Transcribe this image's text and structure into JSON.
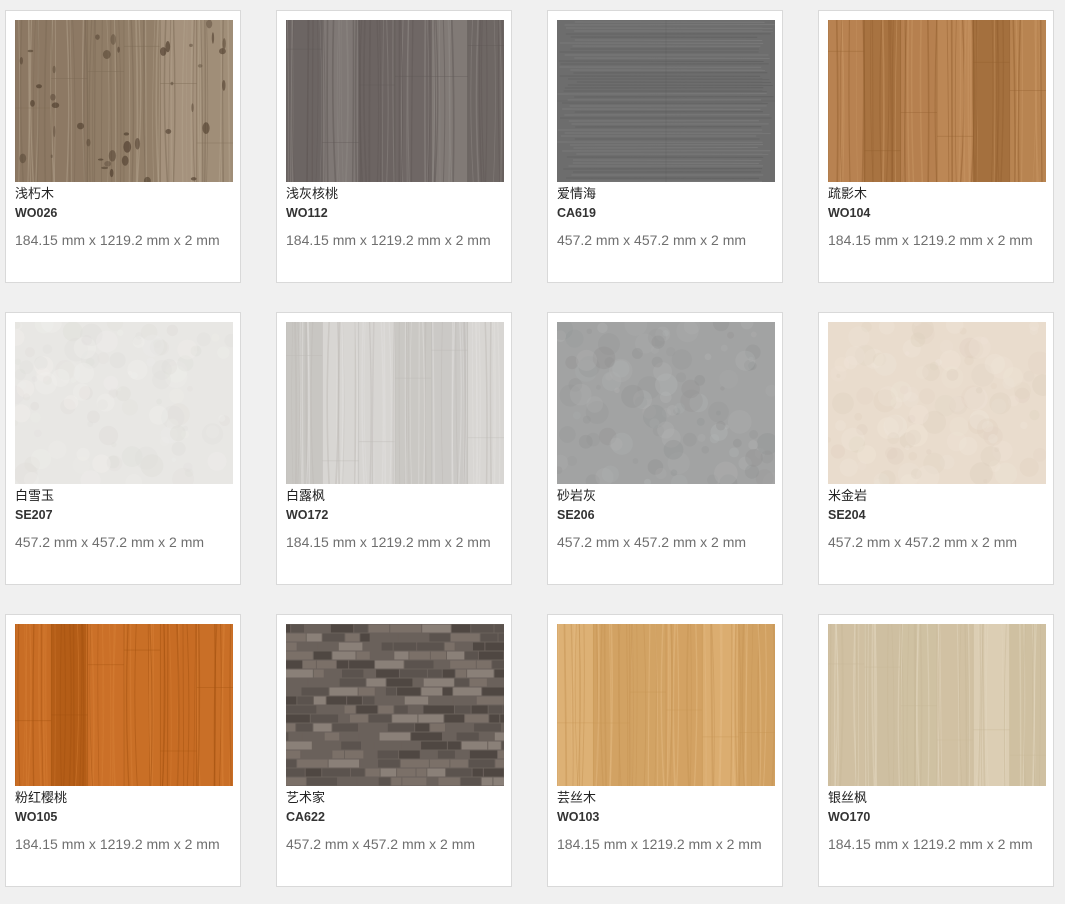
{
  "products": [
    {
      "name": "浅朽木",
      "code": "WO026",
      "size": "184.15 mm x 1219.2 mm x 2 mm",
      "texture": "wood-rustic",
      "colors": [
        "#9a8670",
        "#7c6a55",
        "#b4a38e"
      ]
    },
    {
      "name": "浅灰核桃",
      "code": "WO112",
      "size": "184.15 mm x 1219.2 mm x 2 mm",
      "texture": "wood",
      "colors": [
        "#77706d",
        "#5f5856",
        "#8e8784"
      ]
    },
    {
      "name": "爱情海",
      "code": "CA619",
      "size": "457.2 mm x 457.2 mm x 2 mm",
      "texture": "carpet",
      "colors": [
        "#6d6d6d",
        "#585858",
        "#858585"
      ]
    },
    {
      "name": "疏影木",
      "code": "WO104",
      "size": "184.15 mm x 1219.2 mm x 2 mm",
      "texture": "wood",
      "colors": [
        "#b07a48",
        "#93602f",
        "#c79563"
      ]
    },
    {
      "name": "白雪玉",
      "code": "SE207",
      "size": "457.2 mm x 457.2 mm x 2 mm",
      "texture": "stone",
      "colors": [
        "#e8e7e4",
        "#dcdad6",
        "#f2f1ee"
      ]
    },
    {
      "name": "白露枫",
      "code": "WO172",
      "size": "184.15 mm x 1219.2 mm x 2 mm",
      "texture": "wood",
      "colors": [
        "#d3d1ce",
        "#bdbab6",
        "#e2e0dd"
      ]
    },
    {
      "name": "砂岩灰",
      "code": "SE206",
      "size": "457.2 mm x 457.2 mm x 2 mm",
      "texture": "stone",
      "colors": [
        "#a2a3a3",
        "#8f9090",
        "#b5b6b6"
      ]
    },
    {
      "name": "米金岩",
      "code": "SE204",
      "size": "457.2 mm x 457.2 mm x 2 mm",
      "texture": "stone",
      "colors": [
        "#e9dccd",
        "#ddcebd",
        "#f1e7dc"
      ]
    },
    {
      "name": "粉红樱桃",
      "code": "WO105",
      "size": "184.15 mm x 1219.2 mm x 2 mm",
      "texture": "wood",
      "colors": [
        "#c2661e",
        "#a3520f",
        "#d57d34"
      ]
    },
    {
      "name": "艺术家",
      "code": "CA622",
      "size": "457.2 mm x 457.2 mm x 2 mm",
      "texture": "mosaic",
      "colors": [
        "#6a615b",
        "#4f4742",
        "#8a8078"
      ]
    },
    {
      "name": "芸丝木",
      "code": "WO103",
      "size": "184.15 mm x 1219.2 mm x 2 mm",
      "texture": "wood",
      "colors": [
        "#d8a86a",
        "#c69453",
        "#e4ba82"
      ]
    },
    {
      "name": "银丝枫",
      "code": "WO170",
      "size": "184.15 mm x 1219.2 mm x 2 mm",
      "texture": "wood",
      "colors": [
        "#d6c7ab",
        "#c7b797",
        "#e2d5bd"
      ]
    }
  ]
}
